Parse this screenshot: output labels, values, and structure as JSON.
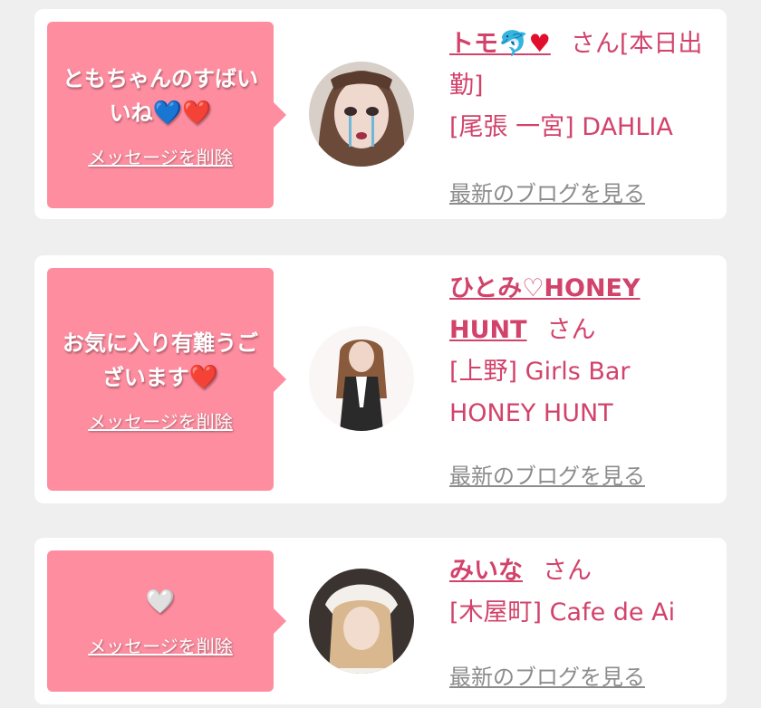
{
  "entries": [
    {
      "message": "ともちゃんのすばいいね",
      "message_hearts": "💙❤️",
      "delete_label": "メッセージを削除",
      "name": "トモ",
      "name_emoji_blue": "🐬",
      "name_emoji_red": "♥",
      "honorific": "さん[本日出勤]",
      "area": "[尾張 一宮]",
      "shop": "DAHLIA",
      "blog_label": "最新のブログを見る"
    },
    {
      "message": "お気に入り有難うございます",
      "message_hearts": "❤️",
      "delete_label": "メッセージを削除",
      "name": "ひとみ♡HONEY HUNT",
      "honorific": "さん",
      "area": "[上野]",
      "shop": "Girls Bar HONEY HUNT",
      "blog_label": "最新のブログを見る"
    },
    {
      "message": "🤍",
      "delete_label": "メッセージを削除",
      "name": "みいな",
      "honorific": "さん",
      "area": "[木屋町]",
      "shop": "Cafe de Ai",
      "blog_label": "最新のブログを見る"
    }
  ],
  "colors": {
    "page_bg": "#efefef",
    "card_bg": "#ffffff",
    "bubble_bg": "#fe8da0",
    "name_pink": "#d2436b",
    "link_gray": "#8c8c8c"
  }
}
